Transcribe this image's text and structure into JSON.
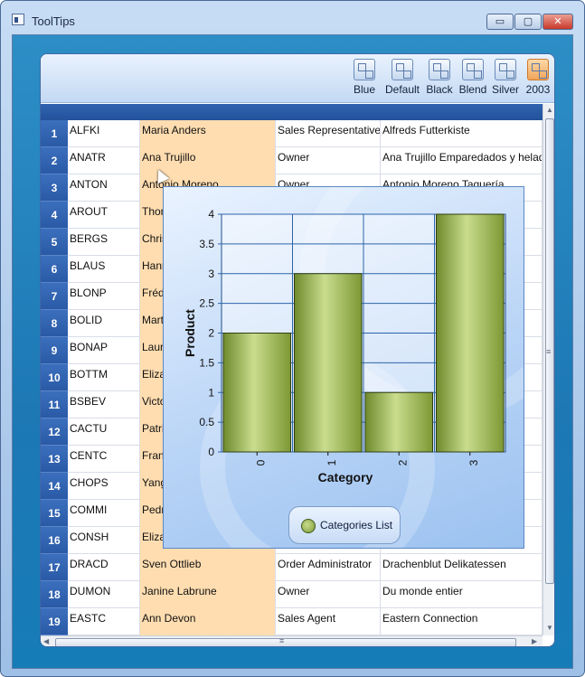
{
  "window": {
    "title": "ToolTips"
  },
  "window_buttons": {
    "minimize": "▭",
    "maximize": "▢",
    "close": "✕"
  },
  "themes": [
    {
      "label": "Blue",
      "icon": "theme-blue-icon",
      "checked": false
    },
    {
      "label": "Default",
      "icon": "theme-default-icon",
      "checked": false
    },
    {
      "label": "Black",
      "icon": "theme-black-icon",
      "checked": false
    },
    {
      "label": "Blend",
      "icon": "theme-blend-icon",
      "checked": false
    },
    {
      "label": "Silver",
      "icon": "theme-silver-icon",
      "checked": false
    },
    {
      "label": "2003",
      "icon": "theme-2003-icon",
      "checked": true
    }
  ],
  "grid": {
    "rows": [
      {
        "num": "1",
        "id": "ALFKI",
        "name": "Maria Anders",
        "title": "Sales Representative",
        "company": "Alfreds Futterkiste"
      },
      {
        "num": "2",
        "id": "ANATR",
        "name": "Ana Trujillo",
        "title": "Owner",
        "company": "Ana Trujillo Emparedados y helad"
      },
      {
        "num": "3",
        "id": "ANTON",
        "name": "Antonio Moreno",
        "title": "Owner",
        "company": "Antonio Moreno Taquería"
      },
      {
        "num": "4",
        "id": "AROUT",
        "name": "Thom",
        "title": "",
        "company": ""
      },
      {
        "num": "5",
        "id": "BERGS",
        "name": "Chris",
        "title": "",
        "company": ""
      },
      {
        "num": "6",
        "id": "BLAUS",
        "name": "Hann",
        "title": "",
        "company": ""
      },
      {
        "num": "7",
        "id": "BLONP",
        "name": "Fréde",
        "title": "",
        "company": ""
      },
      {
        "num": "8",
        "id": "BOLID",
        "name": "Mart",
        "title": "",
        "company": ""
      },
      {
        "num": "9",
        "id": "BONAP",
        "name": "Laure",
        "title": "",
        "company": ""
      },
      {
        "num": "10",
        "id": "BOTTM",
        "name": "Elizab",
        "title": "",
        "company": ""
      },
      {
        "num": "11",
        "id": "BSBEV",
        "name": "Victo",
        "title": "",
        "company": ""
      },
      {
        "num": "12",
        "id": "CACTU",
        "name": "Patric",
        "title": "",
        "company": ""
      },
      {
        "num": "13",
        "id": "CENTC",
        "name": "Franc",
        "title": "",
        "company": ""
      },
      {
        "num": "14",
        "id": "CHOPS",
        "name": "Yang",
        "title": "",
        "company": ""
      },
      {
        "num": "15",
        "id": "COMMI",
        "name": "Pedro",
        "title": "",
        "company": ""
      },
      {
        "num": "16",
        "id": "CONSH",
        "name": "Elizab",
        "title": "",
        "company": ""
      },
      {
        "num": "17",
        "id": "DRACD",
        "name": "Sven Ottlieb",
        "title": "Order Administrator",
        "company": "Drachenblut Delikatessen"
      },
      {
        "num": "18",
        "id": "DUMON",
        "name": "Janine Labrune",
        "title": "Owner",
        "company": "Du monde entier"
      },
      {
        "num": "19",
        "id": "EASTC",
        "name": "Ann Devon",
        "title": "Sales Agent",
        "company": "Eastern Connection"
      }
    ]
  },
  "scrollbar": {
    "grip": "≡"
  },
  "chart_data": {
    "type": "bar",
    "categories": [
      "0",
      "1",
      "2",
      "3"
    ],
    "values": [
      2,
      3,
      1,
      4
    ],
    "xlabel": "Category",
    "ylabel": "Product",
    "ylim": [
      0,
      4
    ],
    "yticks": [
      "0",
      "0.5",
      "1",
      "1.5",
      "2",
      "2.5",
      "3",
      "3.5",
      "4"
    ],
    "series": [
      {
        "name": "Categories List",
        "values": [
          2,
          3,
          1,
          4
        ]
      }
    ],
    "grid": true,
    "legend": "bottom-center",
    "colors": {
      "bar": "#9bbb59",
      "plot_bg": "#ffffff"
    }
  }
}
